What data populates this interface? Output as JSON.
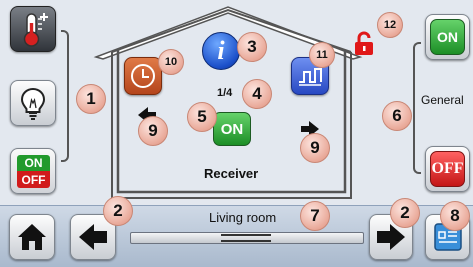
{
  "house": {
    "channel_indicator": "1/4",
    "device_name": "Receiver",
    "on_label": "ON"
  },
  "left_panel": {
    "toggle_on_label": "ON",
    "toggle_off_label": "OFF"
  },
  "right_panel": {
    "group_label": "General",
    "on_label": "ON",
    "off_label": "OFF"
  },
  "bottom_bar": {
    "room_name": "Living room"
  },
  "callouts": {
    "c1": "1",
    "c2a": "2",
    "c2b": "2",
    "c3": "3",
    "c4": "4",
    "c5": "5",
    "c6": "6",
    "c7": "7",
    "c8": "8",
    "c9a": "9",
    "c9b": "9",
    "c10": "10",
    "c11": "11",
    "c12": "12"
  },
  "colors": {
    "on_green": "#1c8e26",
    "off_red": "#c41616",
    "callout_fill": "#e9a999",
    "bar_blue": "#a9b9cd",
    "lock_red": "#e01818"
  },
  "icons": {
    "thermostat": "thermometer-plus-icon",
    "lighting": "light-bulb-icon",
    "timer": "clock-icon",
    "info": "info-icon",
    "pulse": "pulse-wave-icon",
    "lock": "lock-icon",
    "home": "home-icon",
    "settings": "grid-panel-icon"
  }
}
